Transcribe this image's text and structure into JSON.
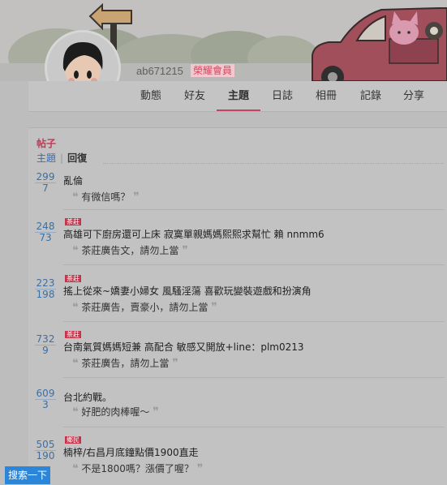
{
  "header": {
    "username": "ab671215",
    "member_badge": "榮耀會員"
  },
  "nav": {
    "items": [
      {
        "label": "動態"
      },
      {
        "label": "好友"
      },
      {
        "label": "主題"
      },
      {
        "label": "日誌"
      },
      {
        "label": "相冊"
      },
      {
        "label": "記錄"
      },
      {
        "label": "分享"
      }
    ],
    "active": "主題"
  },
  "section": {
    "title": "帖子",
    "tabs": [
      {
        "label": "主題"
      },
      {
        "label": "回復"
      }
    ],
    "active_tab": "主題"
  },
  "posts": [
    {
      "views": "299",
      "replies": "7",
      "tag": "",
      "title": "亂倫",
      "quote": "有微信嗎？"
    },
    {
      "views": "248",
      "replies": "73",
      "tag": "茶莊",
      "title": "高雄可下廚房還可上床 寂寞單親媽媽熙熙求幫忙 賴 nnmm6",
      "quote": "茶莊廣告文，請勿上當"
    },
    {
      "views": "223",
      "replies": "198",
      "tag": "茶莊",
      "title": "搖上從來~嬌妻小婦女 風騷淫蕩 喜歡玩變裝遊戲和扮演角",
      "quote": "茶莊廣告，賣豪小，請勿上當"
    },
    {
      "views": "732",
      "replies": "9",
      "tag": "茶莊",
      "title": "台南氣質媽媽短兼 高配合 敏感又開放+line：plm0213",
      "quote": "茶莊廣告，請勿上當"
    },
    {
      "views": "609",
      "replies": "3",
      "tag": "",
      "title": "台北約戰。",
      "quote": "好肥的肉棒喔～"
    },
    {
      "views": "505",
      "replies": "190",
      "tag": "鄉民",
      "title": "楠梓/右昌月底鐘點價1900直走",
      "quote": "不是1800嗎？漲價了喔？"
    }
  ],
  "footer": {
    "search_button": "搜索一下"
  },
  "colors": {
    "accent": "#c4445c",
    "link": "#3b6fa5",
    "search_button": "#2b86d9"
  },
  "icons": [
    "arrow-sign-icon",
    "car-icon",
    "cat-icon",
    "avatar-cartoon-icon",
    "open-quote-icon",
    "close-quote-icon"
  ]
}
